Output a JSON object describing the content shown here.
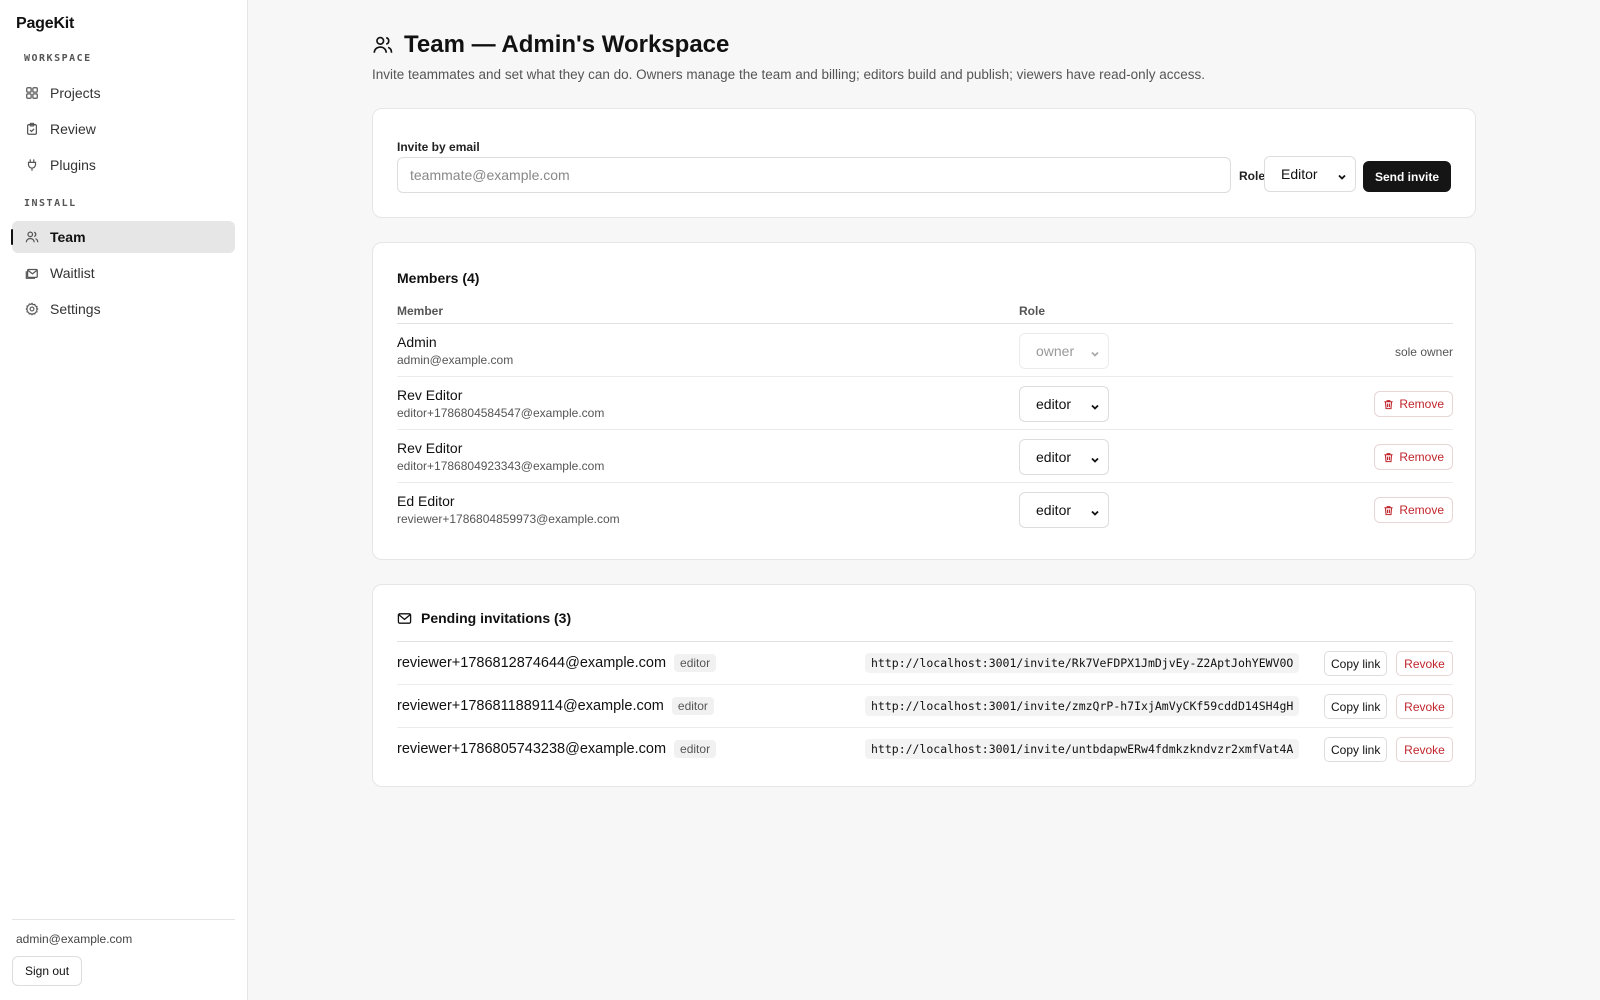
{
  "app": {
    "brand": "PageKit"
  },
  "sidebar": {
    "sections": [
      {
        "label": "WORKSPACE"
      },
      {
        "label": "INSTALL"
      }
    ],
    "items": [
      {
        "label": "Projects",
        "icon": "grid-icon"
      },
      {
        "label": "Review",
        "icon": "clipboard-check-icon"
      },
      {
        "label": "Plugins",
        "icon": "plug-icon"
      },
      {
        "label": "Team",
        "icon": "users-icon",
        "active": true
      },
      {
        "label": "Waitlist",
        "icon": "mail-stack-icon"
      },
      {
        "label": "Settings",
        "icon": "gear-icon"
      }
    ],
    "user_email": "admin@example.com",
    "sign_out_label": "Sign out"
  },
  "page": {
    "title": "Team — Admin's Workspace",
    "description": "Invite teammates and set what they can do. Owners manage the team and billing; editors build and publish; viewers have read-only access."
  },
  "invite": {
    "label": "Invite by email",
    "placeholder": "teammate@example.com",
    "role_label": "Role",
    "role_value": "Editor",
    "send_label": "Send invite"
  },
  "members": {
    "title": "Members (4)",
    "columns": {
      "member": "Member",
      "role": "Role"
    },
    "rows": [
      {
        "name": "Admin",
        "email": "admin@example.com",
        "role": "owner",
        "note": "sole owner"
      },
      {
        "name": "Rev Editor",
        "email": "editor+1786804584547@example.com",
        "role": "editor",
        "action": "Remove"
      },
      {
        "name": "Rev Editor",
        "email": "editor+1786804923343@example.com",
        "role": "editor",
        "action": "Remove"
      },
      {
        "name": "Ed Editor",
        "email": "reviewer+1786804859973@example.com",
        "role": "editor",
        "action": "Remove"
      }
    ]
  },
  "pending": {
    "title": "Pending invitations (3)",
    "copy_label": "Copy link",
    "revoke_label": "Revoke",
    "rows": [
      {
        "email": "reviewer+1786812874644@example.com",
        "role": "editor",
        "link": "http://localhost:3001/invite/Rk7VeFDPX1JmDjvEy-Z2AptJohYEWV0O"
      },
      {
        "email": "reviewer+1786811889114@example.com",
        "role": "editor",
        "link": "http://localhost:3001/invite/zmzQrP-h7IxjAmVyCKf59cddD14SH4gH"
      },
      {
        "email": "reviewer+1786805743238@example.com",
        "role": "editor",
        "link": "http://localhost:3001/invite/untbdapwERw4fdmkzkndvzr2xmfVat4A"
      }
    ]
  },
  "colors": {
    "accent_dark": "#151515",
    "danger": "#c0262d",
    "sidebar_active_bg": "#e6e6e6"
  }
}
